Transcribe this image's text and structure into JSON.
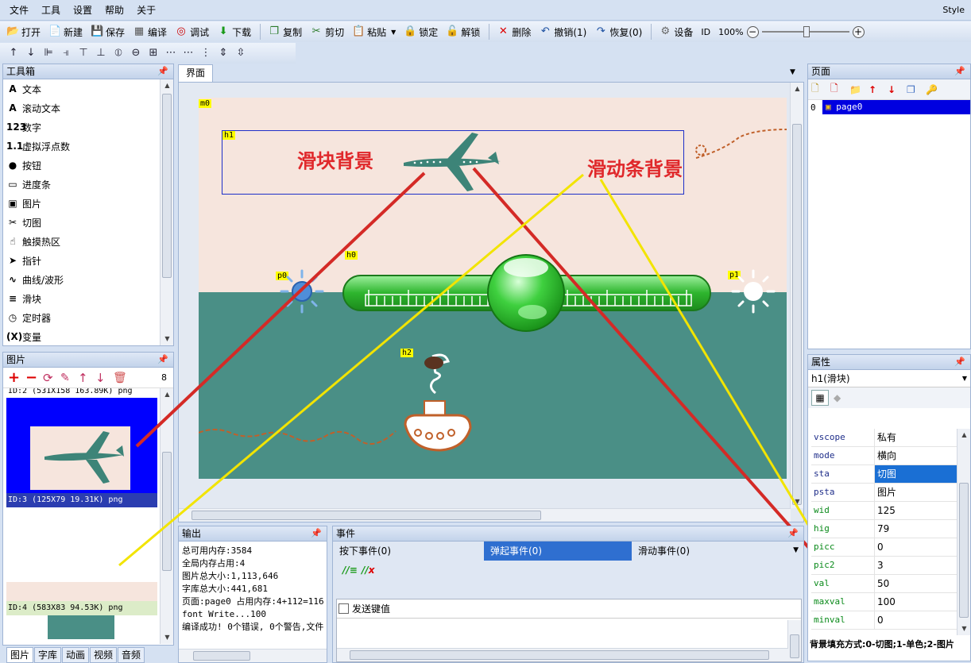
{
  "menu": {
    "items": [
      "文件",
      "工具",
      "设置",
      "帮助",
      "关于"
    ],
    "style_label": "Style"
  },
  "toolbar": {
    "open": "打开",
    "new": "新建",
    "save": "保存",
    "compile": "编译",
    "debug": "调试",
    "download": "下载",
    "copy": "复制",
    "cut": "剪切",
    "paste": "粘贴",
    "lock": "锁定",
    "unlock": "解锁",
    "delete": "删除",
    "undo": "撤销(1)",
    "redo": "恢复(0)",
    "device": "设备",
    "id": "ID",
    "zoom": "100%"
  },
  "toolbox": {
    "title": "工具箱",
    "items": [
      {
        "icon": "A",
        "label": "文本"
      },
      {
        "icon": "A",
        "label": "滚动文本"
      },
      {
        "icon": "123",
        "label": "数字"
      },
      {
        "icon": "1.1",
        "label": "虚拟浮点数"
      },
      {
        "icon": "●",
        "label": "按钮"
      },
      {
        "icon": "▭",
        "label": "进度条"
      },
      {
        "icon": "▣",
        "label": "图片"
      },
      {
        "icon": "✂",
        "label": "切图"
      },
      {
        "icon": "☝",
        "label": "触摸热区"
      },
      {
        "icon": "➤",
        "label": "指针"
      },
      {
        "icon": "∿",
        "label": "曲线/波形"
      },
      {
        "icon": "≡",
        "label": "滑块"
      },
      {
        "icon": "◷",
        "label": "定时器"
      },
      {
        "icon": "(X)",
        "label": "变量"
      }
    ]
  },
  "images": {
    "title": "图片",
    "count": "8",
    "items": [
      {
        "label": "ID:2  (531X158 163.89K) png"
      },
      {
        "label": "ID:3  (125X79 19.31K) png"
      },
      {
        "label": "ID:4  (583X83 94.53K) png"
      }
    ]
  },
  "bottom_tabs": [
    "图片",
    "字库",
    "动画",
    "视频",
    "音频"
  ],
  "editor": {
    "tab": "界面",
    "tags": {
      "m0": "m0",
      "h1": "h1",
      "h0": "h0",
      "p0": "p0",
      "p1": "p1",
      "h2": "h2"
    },
    "annotations": {
      "slider_bg": "滑块背景",
      "track_bg": "滑动条背景"
    }
  },
  "pages": {
    "title": "页面",
    "items": [
      {
        "index": "0",
        "name": "page0"
      }
    ]
  },
  "properties": {
    "title": "属性",
    "selected": "h1(滑块)",
    "rows": [
      {
        "k": "vscope",
        "v": "私有",
        "g": false,
        "sel": false
      },
      {
        "k": "mode",
        "v": "横向",
        "g": false,
        "sel": false
      },
      {
        "k": "sta",
        "v": "切图",
        "g": false,
        "sel": true
      },
      {
        "k": "psta",
        "v": "图片",
        "g": false,
        "sel": false
      },
      {
        "k": "wid",
        "v": "125",
        "g": true,
        "sel": false
      },
      {
        "k": "hig",
        "v": "79",
        "g": true,
        "sel": false
      },
      {
        "k": "picc",
        "v": "0",
        "g": true,
        "sel": false
      },
      {
        "k": "pic2",
        "v": "3",
        "g": true,
        "sel": false
      },
      {
        "k": "val",
        "v": "50",
        "g": true,
        "sel": false
      },
      {
        "k": "maxval",
        "v": "100",
        "g": true,
        "sel": false
      },
      {
        "k": "minval",
        "v": "0",
        "g": true,
        "sel": false
      }
    ],
    "description": "背景填充方式:0-切图;1-单色;2-图片"
  },
  "output": {
    "title": "输出",
    "lines": [
      "总可用内存:3584",
      "全局内存占用:4",
      "图片总大小:1,113,646",
      "字库总大小:441,681",
      "页面:page0 占用内存:4+112=116",
      "font Write...100",
      "编译成功! 0个错误, 0个警告,文件"
    ]
  },
  "events": {
    "title": "事件",
    "tabs": [
      "按下事件(0)",
      "弹起事件(0)",
      "滑动事件(0)"
    ],
    "send_key": "发送键值"
  },
  "colors": {
    "canvas_top": "#f6e5dd",
    "canvas_bottom": "#4a8f86",
    "plane": "#3d8478",
    "slider_green": "#2eb52e",
    "annotation_red": "#e0282b",
    "line_red": "#d42a26",
    "line_yellow": "#f2e400",
    "blue_bg": "#0000ff"
  }
}
